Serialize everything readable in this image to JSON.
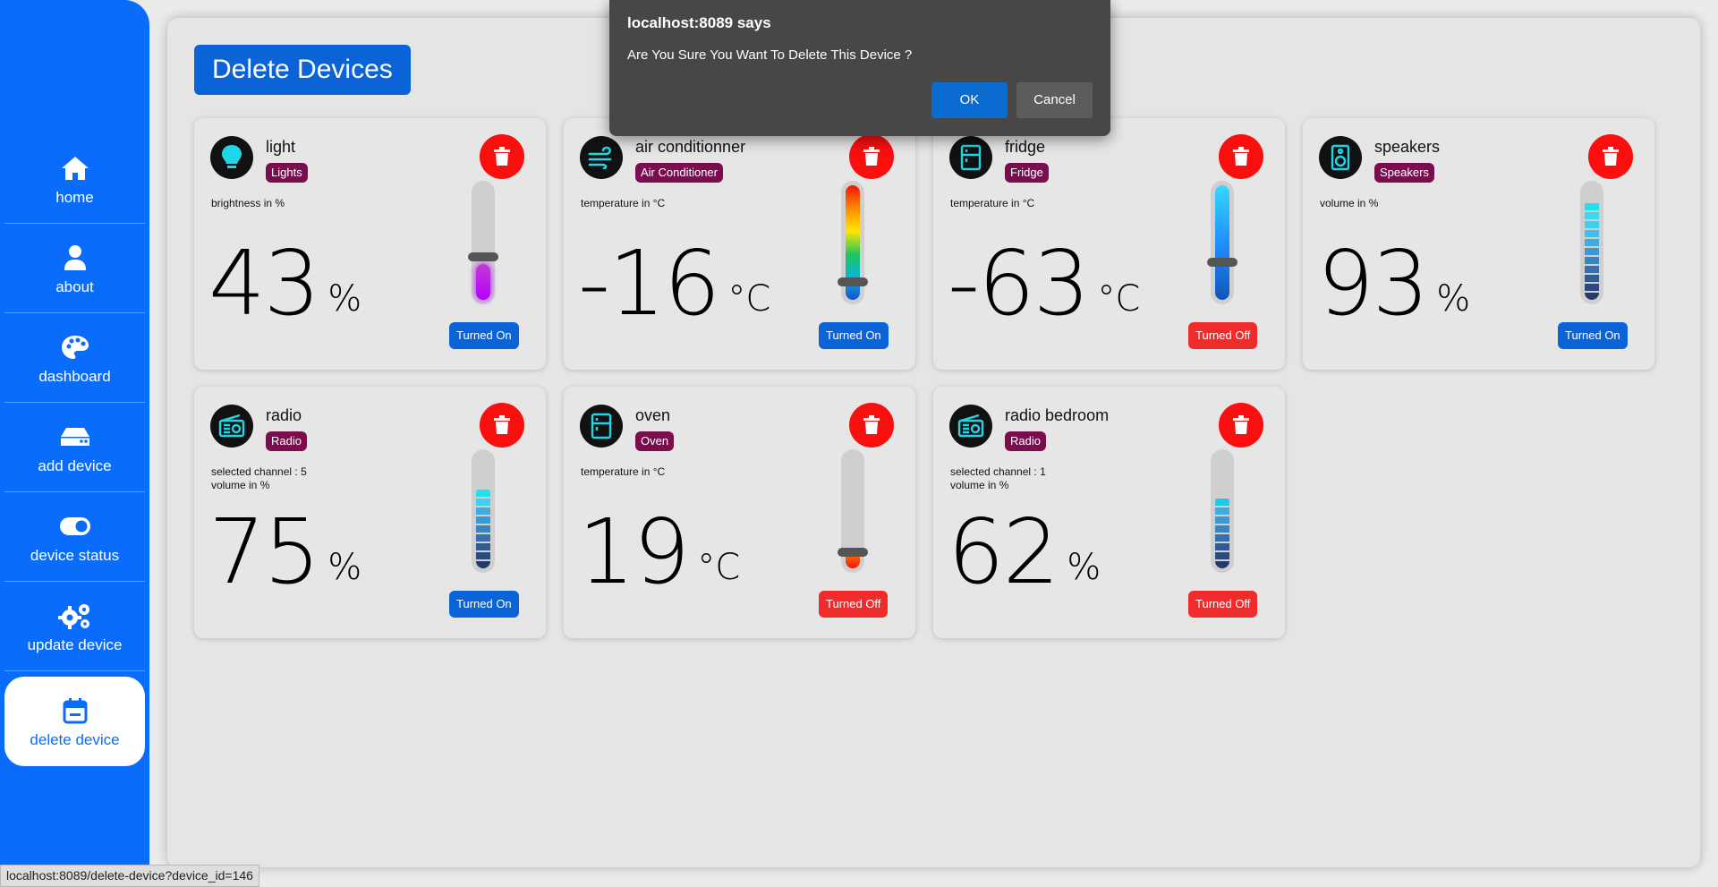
{
  "sidebar": {
    "items": [
      {
        "label": "home",
        "icon": "home-icon"
      },
      {
        "label": "about",
        "icon": "user-icon"
      },
      {
        "label": "dashboard",
        "icon": "palette-icon"
      },
      {
        "label": "add device",
        "icon": "hard-drive-icon"
      },
      {
        "label": "device status",
        "icon": "toggle-icon"
      },
      {
        "label": "update device",
        "icon": "gears-icon"
      },
      {
        "label": "delete device",
        "icon": "calendar-minus-icon"
      }
    ],
    "active_index": 6,
    "color": "#0a6cfb"
  },
  "page": {
    "title": "Delete Devices"
  },
  "devices": [
    {
      "name": "light",
      "tag": "Lights",
      "info1": "brightness in %",
      "info2": "",
      "value": "43",
      "unit": "%",
      "status": "Turned On",
      "icon": "lightbulb-icon",
      "level": 0.43,
      "slider": "purple"
    },
    {
      "name": "air conditionner",
      "tag": "Air Conditioner",
      "info1": "temperature in °C",
      "info2": "",
      "value": "-16",
      "unit": "°C",
      "status": "Turned On",
      "icon": "wind-icon",
      "level": 0.1,
      "slider": "rainbow"
    },
    {
      "name": "fridge",
      "tag": "Fridge",
      "info1": "temperature in °C",
      "info2": "",
      "value": "-63",
      "unit": "°C",
      "status": "Turned Off",
      "icon": "fridge-icon",
      "level": 0.35,
      "slider": "blue"
    },
    {
      "name": "speakers",
      "tag": "Speakers",
      "info1": "volume in %",
      "info2": "",
      "value": "93",
      "unit": "%",
      "status": "Turned On",
      "icon": "speaker-icon",
      "level": 0.93,
      "slider": "segments"
    },
    {
      "name": "radio",
      "tag": "Radio",
      "info1": "selected channel : 5",
      "info2": "volume in %",
      "value": "75",
      "unit": "%",
      "status": "Turned On",
      "icon": "radio-icon",
      "level": 0.75,
      "slider": "segments"
    },
    {
      "name": "oven",
      "tag": "Oven",
      "info1": "temperature in °C",
      "info2": "",
      "value": "19",
      "unit": "°C",
      "status": "Turned Off",
      "icon": "oven-icon",
      "level": 0.12,
      "slider": "orange"
    },
    {
      "name": "radio bedroom",
      "tag": "Radio",
      "info1": "selected channel : 1",
      "info2": "volume in %",
      "value": "62",
      "unit": "%",
      "status": "Turned Off",
      "icon": "radio-icon",
      "level": 0.62,
      "slider": "segments"
    }
  ],
  "dialog": {
    "title": "localhost:8089 says",
    "message": "Are You Sure You Want To Delete This Device ?",
    "ok_label": "OK",
    "cancel_label": "Cancel"
  },
  "status_url": "localhost:8089/delete-device?device_id=146",
  "colors": {
    "tag": "#7b0d4e",
    "on": "#0b63d8",
    "off": "#f02b2b",
    "delete": "#fb0e0e",
    "icon_accent": "#1fd6e6"
  }
}
